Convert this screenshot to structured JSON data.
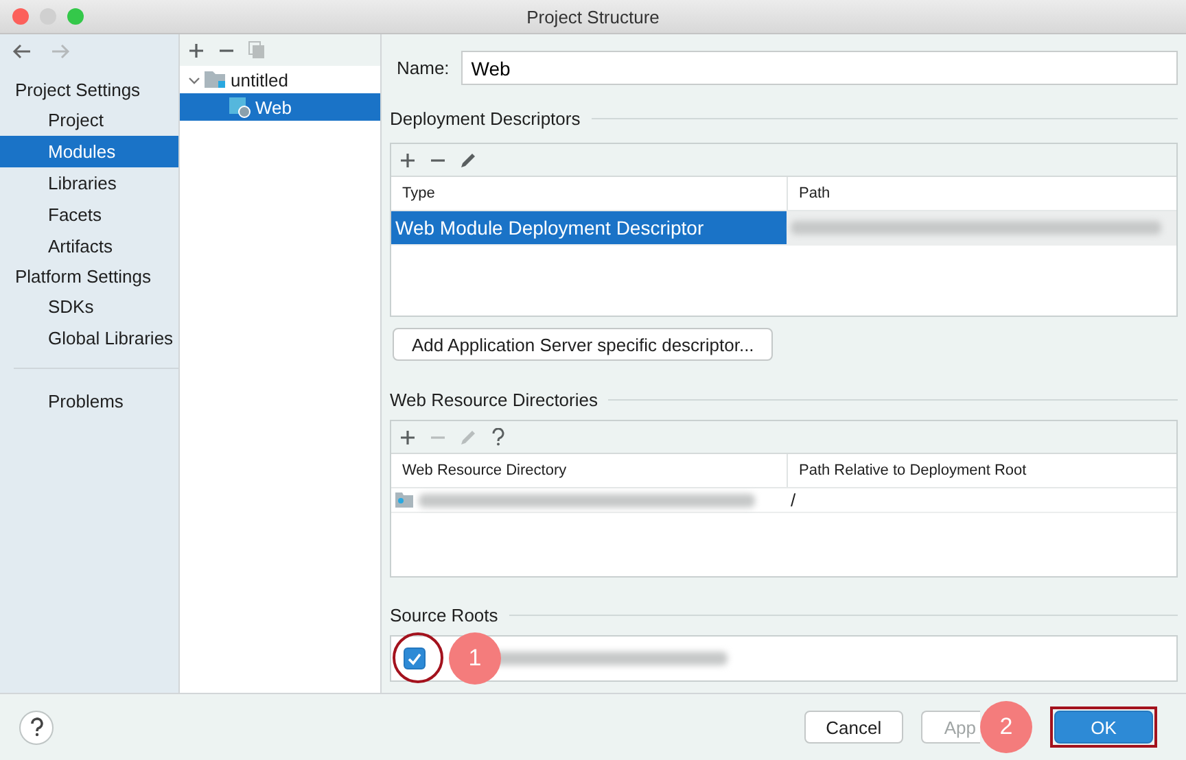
{
  "window": {
    "title": "Project Structure"
  },
  "sidebar": {
    "groups": [
      {
        "title": "Project Settings",
        "items": [
          {
            "label": "Project",
            "selected": false
          },
          {
            "label": "Modules",
            "selected": true
          },
          {
            "label": "Libraries",
            "selected": false
          },
          {
            "label": "Facets",
            "selected": false
          },
          {
            "label": "Artifacts",
            "selected": false
          }
        ]
      },
      {
        "title": "Platform Settings",
        "items": [
          {
            "label": "SDKs",
            "selected": false
          },
          {
            "label": "Global Libraries",
            "selected": false
          }
        ]
      },
      {
        "items": [
          {
            "label": "Problems",
            "selected": false
          }
        ]
      }
    ]
  },
  "tree": {
    "nodes": [
      {
        "label": "untitled",
        "kind": "folder",
        "expanded": true,
        "selected": false,
        "children": [
          {
            "label": "Web",
            "kind": "web",
            "selected": true
          }
        ]
      }
    ]
  },
  "name_field": {
    "label": "Name:",
    "value": "Web"
  },
  "deployment_descriptors": {
    "title": "Deployment Descriptors",
    "toolbar": [
      {
        "kind": "add",
        "disabled": false
      },
      {
        "kind": "remove",
        "disabled": false
      },
      {
        "kind": "edit",
        "disabled": false
      }
    ],
    "columns": [
      "Type",
      "Path"
    ],
    "rows": [
      {
        "type": "Web Module Deployment Descriptor",
        "selected": true
      }
    ],
    "button": "Add Application Server specific descriptor..."
  },
  "web_resource_directories": {
    "title": "Web Resource Directories",
    "toolbar": [
      {
        "kind": "add",
        "disabled": false
      },
      {
        "kind": "remove",
        "disabled": true
      },
      {
        "kind": "edit",
        "disabled": true
      },
      {
        "kind": "help",
        "disabled": false
      }
    ],
    "columns": [
      "Web Resource Directory",
      "Path Relative to Deployment Root"
    ],
    "rows": [
      {
        "relative_path": "/",
        "selected": false
      }
    ]
  },
  "source_roots": {
    "title": "Source Roots",
    "items": [
      {
        "checked": true
      }
    ]
  },
  "annotations": [
    {
      "label": "1"
    },
    {
      "label": "2"
    }
  ],
  "footer": {
    "buttons": [
      {
        "label": "Cancel",
        "kind": "plain",
        "disabled": false
      },
      {
        "label": "App",
        "kind": "plain",
        "disabled": true
      },
      {
        "label": "OK",
        "kind": "primary",
        "disabled": false
      }
    ]
  }
}
